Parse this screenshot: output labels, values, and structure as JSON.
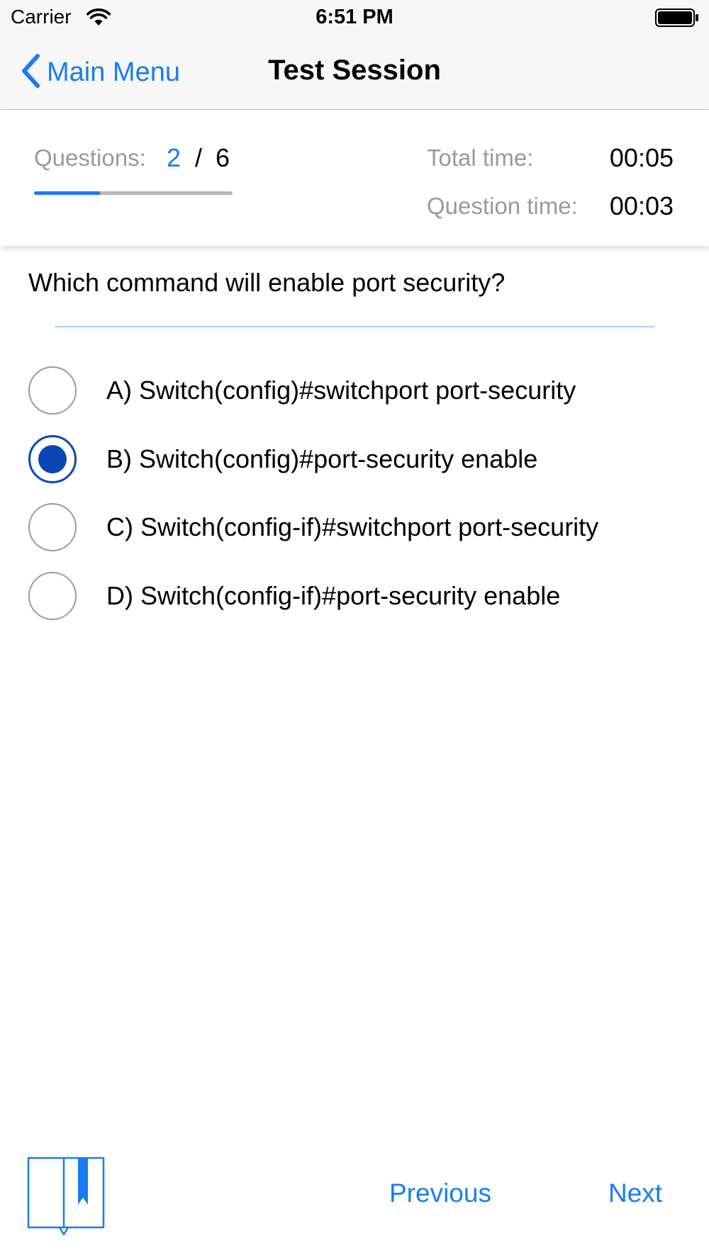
{
  "status_bar": {
    "carrier": "Carrier",
    "time": "6:51 PM"
  },
  "nav": {
    "back_label": "Main Menu",
    "title": "Test Session"
  },
  "progress": {
    "questions_label": "Questions:",
    "current": "2",
    "separator": "/",
    "total": "6",
    "fraction": 0.333
  },
  "timers": {
    "total_label": "Total time:",
    "total_value": "00:05",
    "question_label": "Question time:",
    "question_value": "00:03"
  },
  "question": {
    "text": "Which command will enable port security?"
  },
  "options": [
    {
      "label": "A) Switch(config)#switchport port-security",
      "selected": false
    },
    {
      "label": "B) Switch(config)#port-security enable",
      "selected": true
    },
    {
      "label": "C) Switch(config-if)#switchport port-security",
      "selected": false
    },
    {
      "label": "D) Switch(config-if)#port-security enable",
      "selected": false
    }
  ],
  "toolbar": {
    "previous_label": "Previous",
    "next_label": "Next",
    "bookmark_icon": "bookmark-book-icon"
  },
  "colors": {
    "accent": "#1a7cf2",
    "selected_radio": "#0a47b5",
    "muted_text": "#9a9a9a",
    "divider": "#a9d4f8"
  }
}
